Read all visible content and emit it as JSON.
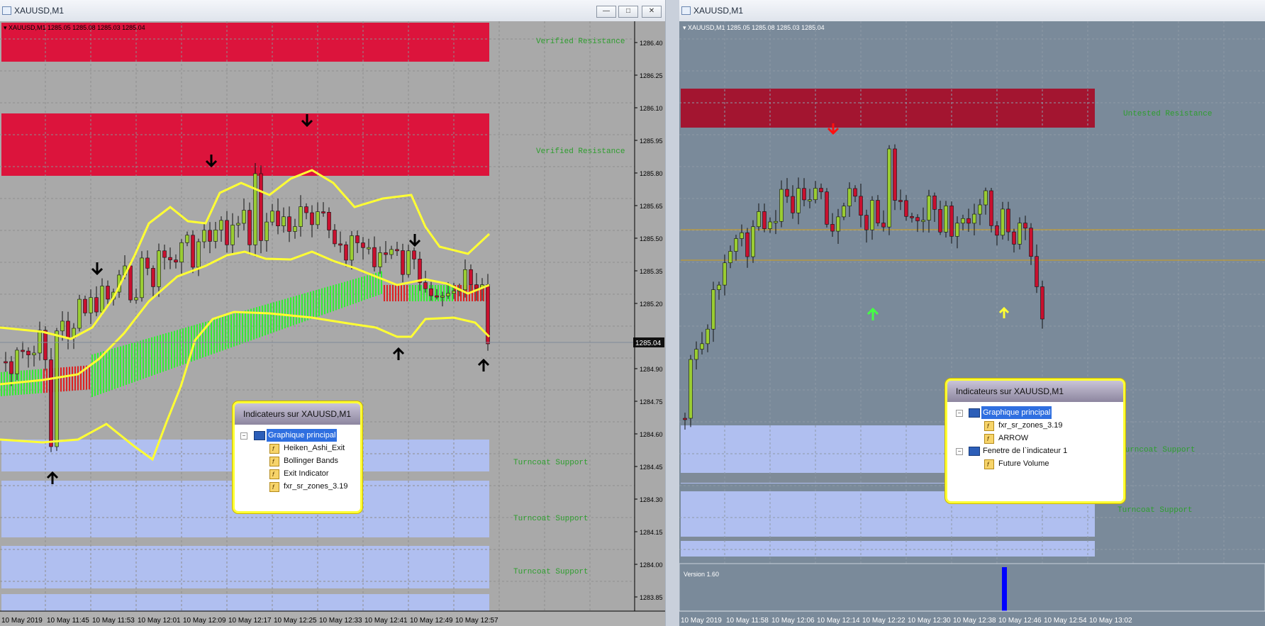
{
  "left_window": {
    "title": "XAUUSD,M1",
    "chart_header": "XAUUSD,M1  1285.05 1285.08 1285.03 1285.04",
    "buttons": [
      "—",
      "□",
      "✕"
    ],
    "zone_labels": [
      "Verified Resistance",
      "Verified Resistance",
      "Turncoat Support",
      "Turncoat Support",
      "Turncoat Support"
    ],
    "price_axis": [
      "1286.40",
      "1286.25",
      "1286.10",
      "1285.95",
      "1285.80",
      "1285.65",
      "1285.50",
      "1285.35",
      "1285.20",
      "1284.90",
      "1284.75",
      "1284.60",
      "1284.45",
      "1284.30",
      "1284.15",
      "1284.00",
      "1283.85"
    ],
    "current_price": "1285.04",
    "time_axis": [
      "10 May 2019",
      "10 May 11:45",
      "10 May 11:53",
      "10 May 12:01",
      "10 May 12:09",
      "10 May 12:17",
      "10 May 12:25",
      "10 May 12:33",
      "10 May 12:41",
      "10 May 12:49",
      "10 May 12:57"
    ],
    "dialog": {
      "title": "Indicateurs sur XAUUSD,M1",
      "root": "Graphique principal",
      "items": [
        "Heiken_Ashi_Exit",
        "Bollinger Bands",
        "Exit Indicator",
        "fxr_sr_zones_3.19"
      ]
    }
  },
  "right_window": {
    "title": "XAUUSD,M1",
    "chart_header": "XAUUSD,M1  1285.05 1285.08 1285.03 1285.04",
    "zone_labels": [
      "Untested Resistance",
      "Turncoat Support",
      "Turncoat Support"
    ],
    "subwindow_label": "Version 1.60",
    "time_axis": [
      "10 May 2019",
      "10 May 11:58",
      "10 May 12:06",
      "10 May 12:14",
      "10 May 12:22",
      "10 May 12:30",
      "10 May 12:38",
      "10 May 12:46",
      "10 May 12:54",
      "10 May 13:02"
    ],
    "dialog": {
      "title": "Indicateurs sur XAUUSD,M1",
      "root": "Graphique principal",
      "items": [
        "fxr_sr_zones_3.19",
        "ARROW"
      ],
      "root2": "Fenetre de l`indicateur 1",
      "items2": [
        "Future Volume"
      ]
    }
  },
  "colors": {
    "left_bg": "#a9a9a9",
    "right_bg": "#7a8a9a",
    "resistance": "#dc143c",
    "resistance_dark": "#a31530",
    "support": "#b0bff0",
    "bollinger": "#ffff33",
    "bull_candle": "#9acd32",
    "bear_candle": "#c8102e",
    "ha_green": "#33ee33",
    "ha_red": "#dd2222"
  }
}
